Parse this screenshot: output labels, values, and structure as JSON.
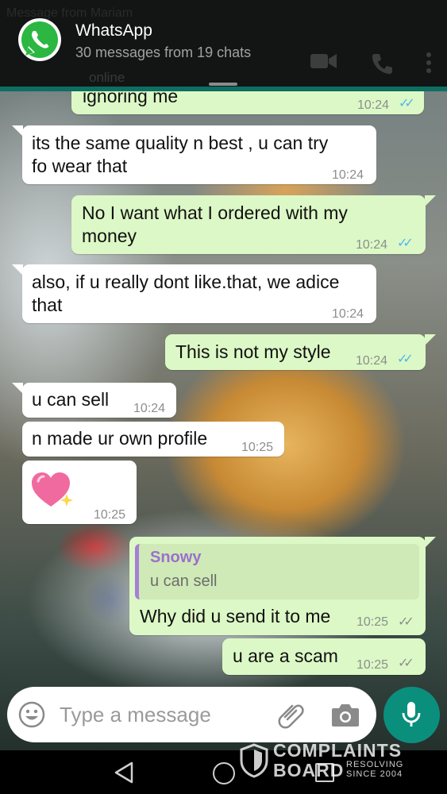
{
  "notification": {
    "app_name": "WhatsApp",
    "summary": "30 messages from 19 chats",
    "ghost_title": "Message from Mariam",
    "ghost_status": "online"
  },
  "messages": [
    {
      "dir": "out",
      "text": "ignoring me",
      "time": "10:24",
      "status": "read"
    },
    {
      "dir": "in",
      "line1": "its the same quality n best , u can try",
      "line2": "fo wear that",
      "time": "10:24"
    },
    {
      "dir": "out",
      "line1": "No I want what I ordered with my",
      "line2": "money",
      "time": "10:24",
      "status": "read"
    },
    {
      "dir": "in",
      "line1": "also, if u really dont like.that, we adice",
      "line2": "that",
      "time": "10:24"
    },
    {
      "dir": "out",
      "text": "This is not my style",
      "time": "10:24",
      "status": "read"
    },
    {
      "dir": "in",
      "text": "u can sell",
      "time": "10:24"
    },
    {
      "dir": "in",
      "text": "n made ur own profile",
      "time": "10:25"
    },
    {
      "dir": "in",
      "emoji": "sparkling-heart",
      "time": "10:25"
    },
    {
      "dir": "out",
      "reply_to": {
        "name": "Snowy",
        "text": "u can sell"
      },
      "text": "Why did u send it to me",
      "time": "10:25",
      "status": "delivered"
    },
    {
      "dir": "out",
      "text": "u are a scam",
      "time": "10:25",
      "status": "delivered"
    }
  ],
  "composer": {
    "placeholder": "Type a message"
  },
  "watermark": {
    "line1": "COMPLAINTS",
    "line2": "BOARD",
    "tag1": "RESOLVING",
    "tag2": "SINCE 2004"
  },
  "colors": {
    "incoming": "#ffffff",
    "outgoing": "#dcf8c6",
    "accent": "#0b8f7d",
    "read_tick": "#4fb6ec",
    "quote_bar": "#a57fd6"
  }
}
